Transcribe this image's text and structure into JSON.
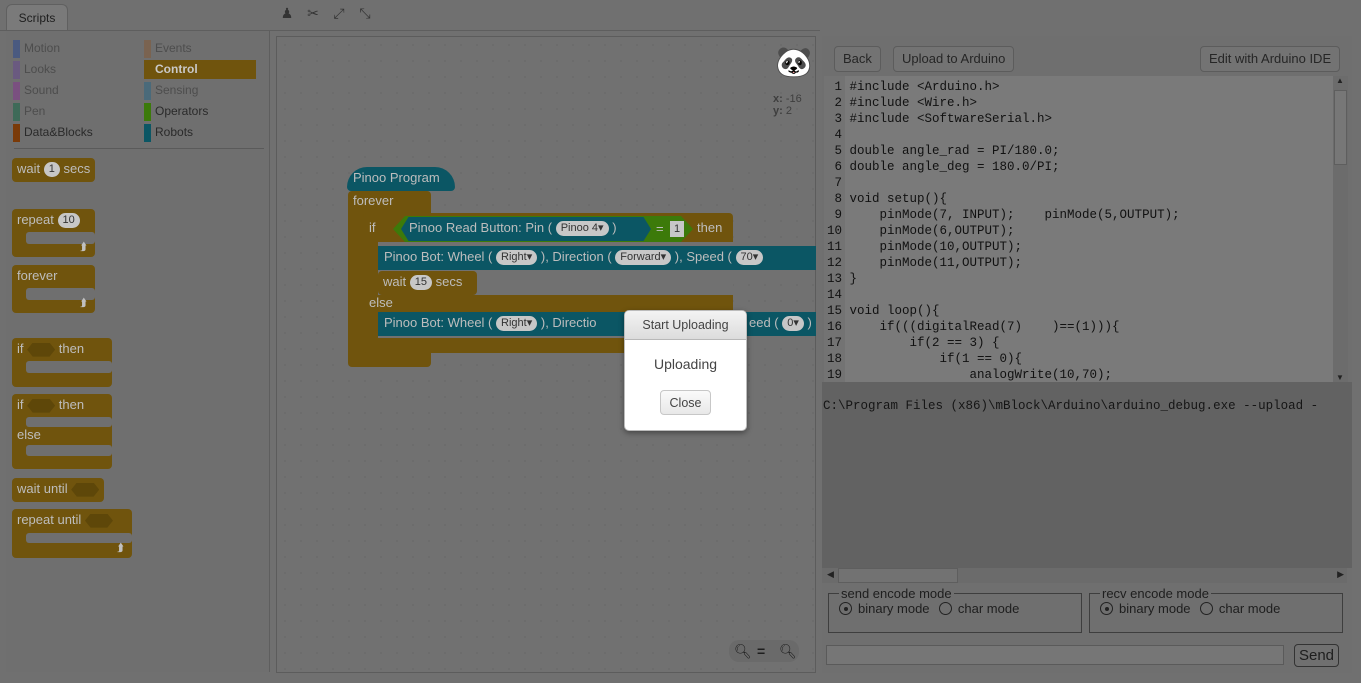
{
  "tabs": [
    {
      "label": "Scripts"
    }
  ],
  "toolbar": {
    "icons": [
      "stamp-icon",
      "scissors-icon",
      "grow-icon",
      "shrink-icon"
    ]
  },
  "palette": {
    "categories": [
      {
        "label": "Motion",
        "color": "#4a5a80"
      },
      {
        "label": "Looks",
        "color": "#6a5a80"
      },
      {
        "label": "Sound",
        "color": "#7a5080"
      },
      {
        "label": "Pen",
        "color": "#3e6a58"
      },
      {
        "label": "Data&Blocks",
        "color": "#7a3a08"
      },
      {
        "label": "Events",
        "color": "#7a6350"
      },
      {
        "label": "Control",
        "color": "#70540d"
      },
      {
        "label": "Sensing",
        "color": "#4a6a7a"
      },
      {
        "label": "Operators",
        "color": "#3c7a0a"
      },
      {
        "label": "Robots",
        "color": "#0b5664"
      }
    ],
    "blocks": {
      "wait": "wait",
      "wait_val": "1",
      "secs": "secs",
      "repeat": "repeat",
      "repeat_val": "10",
      "forever": "forever",
      "if": "if",
      "then": "then",
      "else": "else",
      "wait_until": "wait until",
      "repeat_until": "repeat until"
    }
  },
  "sprite": {
    "x_label": "x:",
    "x": "-16",
    "y_label": "y:",
    "y": "2"
  },
  "script": {
    "hat": "Pinoo Program",
    "forever": "forever",
    "if": "if",
    "then": "then",
    "else": "else",
    "read_button": "Pinoo Read Button: Pin (",
    "pin": "Pinoo 4",
    "close_paren": ")",
    "eq": "=",
    "eq_val": "1",
    "wheel1": {
      "a": "Pinoo Bot: Wheel (",
      "wheel": "Right",
      "b": "), Direction (",
      "dir": "Forward",
      "c": "), Speed (",
      "speed": "70"
    },
    "wait": "wait",
    "wait_val": "15",
    "secs": "secs",
    "wheel2": {
      "a": "Pinoo Bot: Wheel (",
      "wheel": "Right",
      "b": "), Directio",
      "c": "eed (",
      "speed": "0",
      "d": ")"
    }
  },
  "right_panel": {
    "back": "Back",
    "upload": "Upload to Arduino",
    "edit_ide": "Edit with Arduino IDE",
    "code_lines": [
      "#include <Arduino.h>",
      "#include <Wire.h>",
      "#include <SoftwareSerial.h>",
      "",
      "double angle_rad = PI/180.0;",
      "double angle_deg = 180.0/PI;",
      "",
      "void setup(){",
      "    pinMode(7, INPUT);    pinMode(5,OUTPUT);",
      "    pinMode(6,OUTPUT);",
      "    pinMode(10,OUTPUT);",
      "    pinMode(11,OUTPUT);",
      "}",
      "",
      "void loop(){",
      "    if(((digitalRead(7)    )==(1))){",
      "        if(2 == 3) {",
      "            if(1 == 0){",
      "                analogWrite(10,70);"
    ],
    "console": "C:\\Program Files (x86)\\mBlock\\Arduino\\arduino_debug.exe --upload -",
    "send_mode": {
      "legend": "send encode mode",
      "binary": "binary mode",
      "char": "char mode",
      "selected": "binary"
    },
    "recv_mode": {
      "legend": "recv encode mode",
      "binary": "binary mode",
      "char": "char mode",
      "selected": "binary"
    },
    "input_value": "",
    "send": "Send"
  },
  "dialog": {
    "title": "Start Uploading",
    "message": "Uploading",
    "close": "Close"
  }
}
